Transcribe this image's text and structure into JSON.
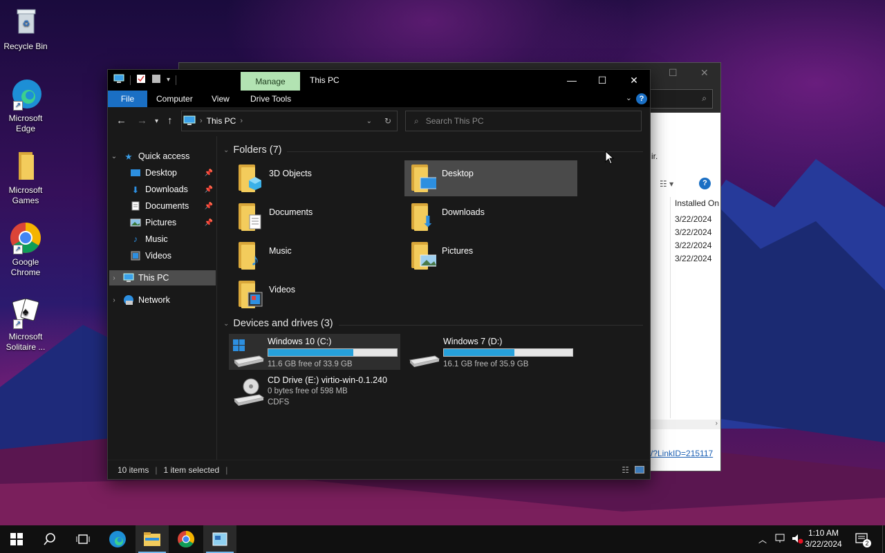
{
  "desktop": {
    "icons": [
      {
        "label": "Recycle Bin",
        "icon": "recycle-bin-icon"
      },
      {
        "label": "Microsoft Edge",
        "icon": "edge-icon"
      },
      {
        "label": "Microsoft Games",
        "icon": "folder-icon"
      },
      {
        "label": "Google Chrome",
        "icon": "chrome-icon"
      },
      {
        "label": "Microsoft Solitaire ...",
        "icon": "solitaire-icon"
      }
    ]
  },
  "background_window": {
    "header_text": "ir.",
    "column_header": "Installed On",
    "dates": [
      "3/22/2024",
      "3/22/2024",
      "3/22/2024",
      "3/22/2024"
    ],
    "link_text": "/?LinkID=215117"
  },
  "explorer": {
    "title": "This PC",
    "manage_tab": "Manage",
    "ribbon_tabs": {
      "file": "File",
      "computer": "Computer",
      "view": "View",
      "drive_tools": "Drive Tools"
    },
    "help": "?",
    "address": {
      "location": "This PC"
    },
    "search": {
      "placeholder": "Search This PC"
    },
    "sidebar": {
      "quick_access": "Quick access",
      "items": [
        {
          "label": "Desktop",
          "pinned": true
        },
        {
          "label": "Downloads",
          "pinned": true
        },
        {
          "label": "Documents",
          "pinned": true
        },
        {
          "label": "Pictures",
          "pinned": true
        },
        {
          "label": "Music",
          "pinned": false
        },
        {
          "label": "Videos",
          "pinned": false
        }
      ],
      "this_pc": "This PC",
      "network": "Network"
    },
    "folders_header": "Folders (7)",
    "folders": [
      {
        "name": "3D Objects"
      },
      {
        "name": "Desktop",
        "selected": true
      },
      {
        "name": "Documents"
      },
      {
        "name": "Downloads"
      },
      {
        "name": "Music"
      },
      {
        "name": "Pictures"
      },
      {
        "name": "Videos"
      }
    ],
    "devices_header": "Devices and drives (3)",
    "drives": [
      {
        "name": "Windows 10 (C:)",
        "free_text": "11.6 GB free of 33.9 GB",
        "used_fraction": 0.66
      },
      {
        "name": "Windows 7 (D:)",
        "free_text": "16.1 GB free of 35.9 GB",
        "used_fraction": 0.55
      },
      {
        "name": "CD Drive (E:) virtio-win-0.1.240",
        "free_text": "0 bytes free of 598 MB",
        "fs": "CDFS"
      }
    ],
    "status": {
      "items": "10 items",
      "selected": "1 item selected"
    }
  },
  "taskbar": {
    "apps": [
      "start-icon",
      "search-icon",
      "task-view-icon",
      "edge-icon",
      "file-explorer-icon",
      "chrome-icon",
      "app-icon"
    ],
    "time": "1:10 AM",
    "date": "3/22/2024",
    "notification_count": "2"
  },
  "colors": {
    "accent": "#1a6fc4",
    "manage_tab": "#b2e3b2",
    "drive_bar": "#26a0da",
    "folder": "#f3cc5c"
  }
}
